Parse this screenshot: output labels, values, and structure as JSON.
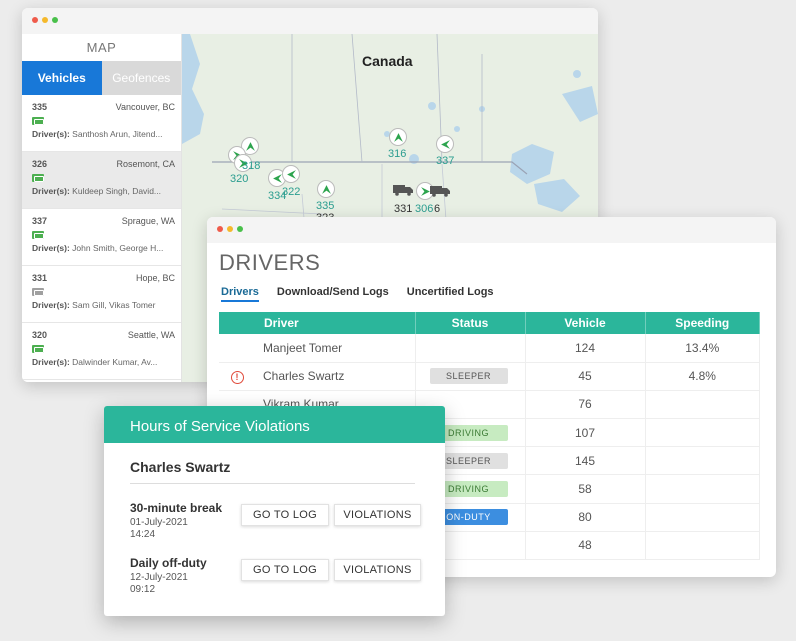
{
  "colors": {
    "accent": "#2bb69b",
    "blue": "#1878d8",
    "alert": "#e04b3b"
  },
  "map": {
    "heading": "MAP",
    "tabs": [
      "Vehicles",
      "Geofences"
    ],
    "country_label": "Canada",
    "vehicles": [
      {
        "number": "335",
        "location": "Vancouver, BC",
        "drivers_label": "Driver(s):",
        "drivers": "Santhosh Arun, Jitend...",
        "badge": "green"
      },
      {
        "number": "326",
        "location": "Rosemont, CA",
        "drivers_label": "Driver(s):",
        "drivers": "Kuldeep Singh, David...",
        "badge": "green"
      },
      {
        "number": "337",
        "location": "Sprague, WA",
        "drivers_label": "Driver(s):",
        "drivers": "John Smith, George H...",
        "badge": "green"
      },
      {
        "number": "331",
        "location": "Hope, BC",
        "drivers_label": "Driver(s):",
        "drivers": "Sam Gill, Vikas Tomer",
        "badge": "gray"
      },
      {
        "number": "320",
        "location": "Seattle, WA",
        "drivers_label": "Driver(s):",
        "drivers": "Dalwinder Kumar, Av...",
        "badge": "green"
      }
    ],
    "markers": [
      "316",
      "337",
      "318",
      "320",
      "334",
      "322",
      "335",
      "331",
      "306",
      "6",
      "323"
    ]
  },
  "drivers": {
    "title": "DRIVERS",
    "tabs": [
      "Drivers",
      "Download/Send Logs",
      "Uncertified Logs"
    ],
    "columns": [
      "Driver",
      "Status",
      "Vehicle",
      "Speeding"
    ],
    "rows": [
      {
        "alert": false,
        "name": "Manjeet Tomer",
        "status": "",
        "vehicle": "124",
        "speeding": "13.4%"
      },
      {
        "alert": true,
        "name": "Charles Swartz",
        "status": "SLEEPER",
        "vehicle": "45",
        "speeding": "4.8%"
      },
      {
        "alert": false,
        "name": "Vikram Kumar",
        "status": "",
        "vehicle": "76",
        "speeding": ""
      },
      {
        "alert": false,
        "name": "",
        "status": "DRIVING",
        "vehicle": "107",
        "speeding": ""
      },
      {
        "alert": false,
        "name": "",
        "status": "SLEEPER",
        "vehicle": "145",
        "speeding": ""
      },
      {
        "alert": false,
        "name": "",
        "status": "DRIVING",
        "vehicle": "58",
        "speeding": ""
      },
      {
        "alert": false,
        "name": "",
        "status": "ON-DUTY",
        "vehicle": "80",
        "speeding": ""
      },
      {
        "alert": false,
        "name": "",
        "status": "",
        "vehicle": "48",
        "speeding": ""
      }
    ]
  },
  "hos": {
    "title": "Hours of Service Violations",
    "driver": "Charles Swartz",
    "violations": [
      {
        "title": "30-minute break",
        "date": "01-July-2021",
        "time": "14:24"
      },
      {
        "title": "Daily off-duty",
        "date": "12-July-2021",
        "time": "09:12"
      }
    ],
    "go_to_log_label": "GO TO LOG",
    "violations_label": "VIOLATIONS"
  }
}
